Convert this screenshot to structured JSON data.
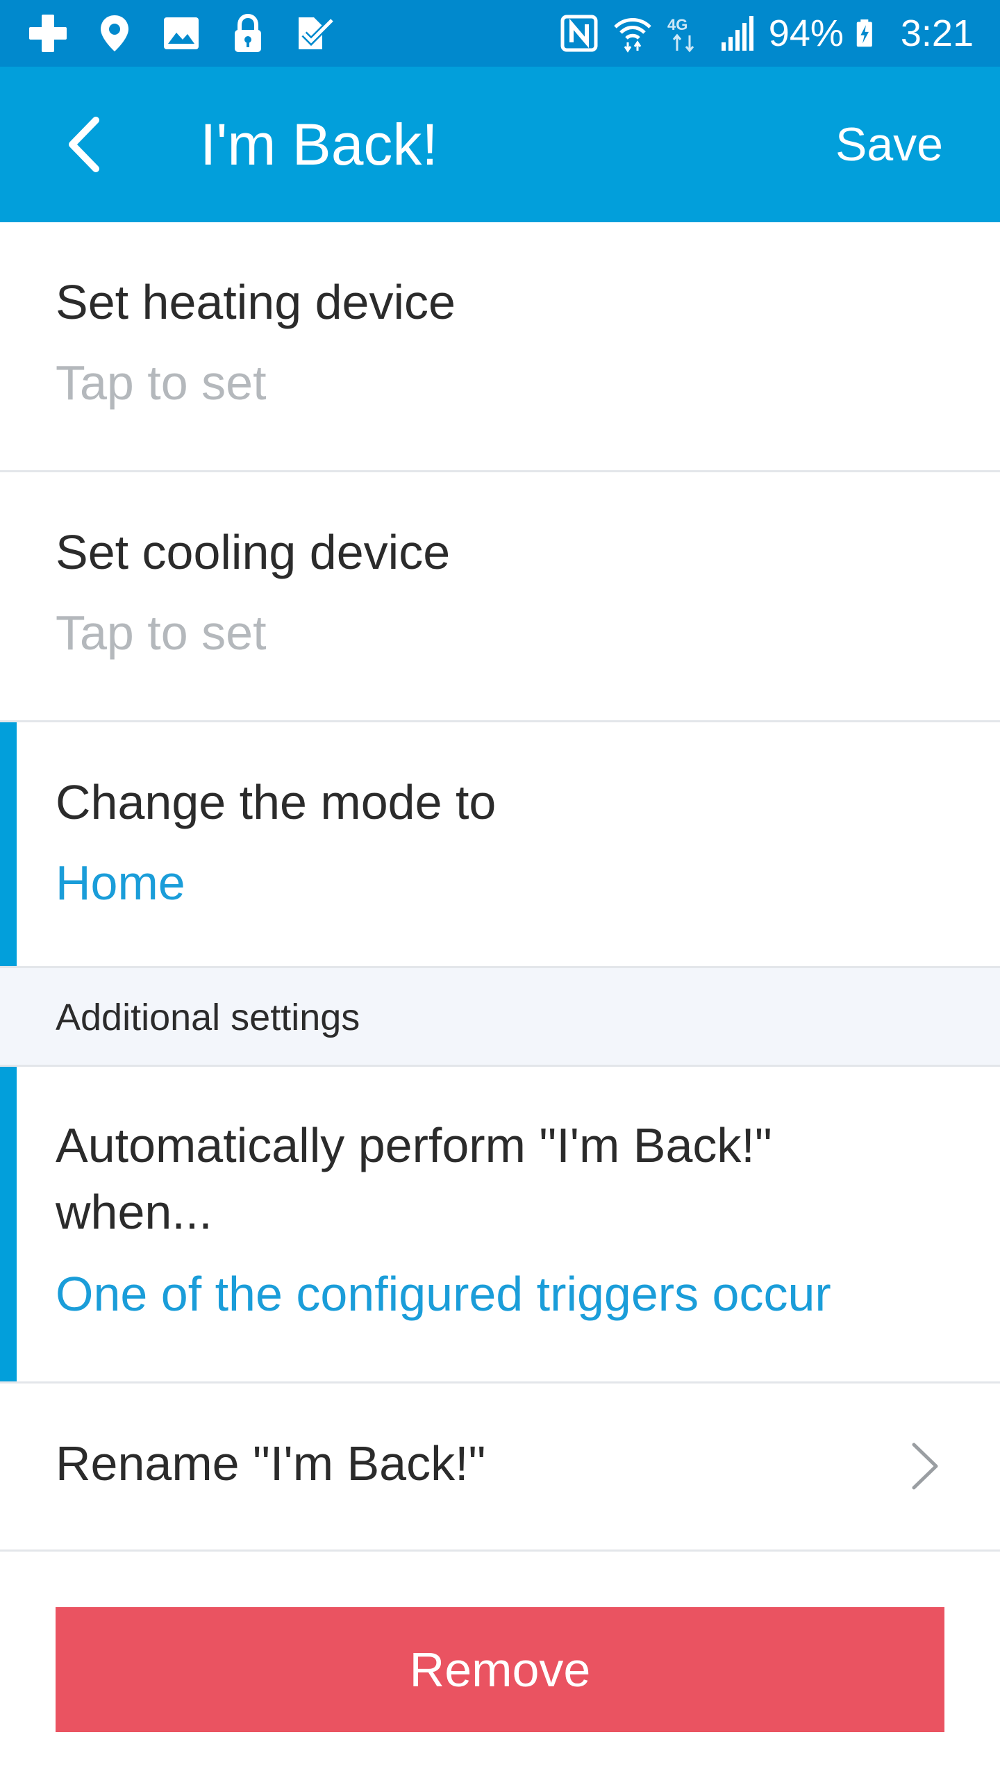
{
  "status_bar": {
    "icons_left": [
      "plus-icon",
      "location-pin-icon",
      "image-icon",
      "lock-icon",
      "task-check-icon"
    ],
    "icons_right": [
      "nfc-icon",
      "wifi-icon",
      "4g-icon",
      "signal-icon",
      "battery-charging-icon"
    ],
    "battery": "94%",
    "time": "3:21"
  },
  "app_bar": {
    "title": "I'm Back!",
    "save_label": "Save"
  },
  "heating": {
    "title": "Set heating device",
    "value": "Tap to set"
  },
  "cooling": {
    "title": "Set cooling device",
    "value": "Tap to set"
  },
  "mode": {
    "title": "Change the mode to",
    "value": "Home"
  },
  "additional": {
    "header": "Additional settings",
    "auto_title_line1": "Automatically perform \"I'm Back!\"",
    "auto_title_line2": "when...",
    "auto_value": "One of the configured triggers occur"
  },
  "rename": {
    "label": "Rename \"I'm Back!\""
  },
  "remove": {
    "label": "Remove"
  },
  "colors": {
    "status_bar": "#0189cd",
    "app_bar": "#029fdb",
    "accent": "#1a9dd9",
    "remove": "#ea5361",
    "section_bg": "#f3f6fb"
  }
}
